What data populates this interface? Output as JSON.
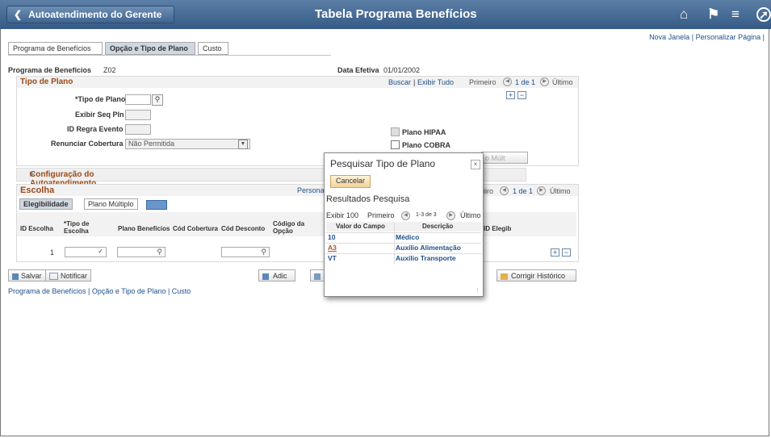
{
  "header": {
    "back_label": "Autoatendimento do Gerente",
    "title": "Tabela Programa Benefícios",
    "home_icon": "home-icon",
    "flag_icon": "flag-icon",
    "menu_icon": "menu-icon",
    "nav_icon": "compass-icon"
  },
  "toplinks": {
    "new_window": "Nova Janela",
    "separator": "|",
    "personalize": "Personalizar Página"
  },
  "tabs": [
    {
      "label": "Programa de Benefícios"
    },
    {
      "label": "Opção e Tipo de Plano"
    },
    {
      "label": "Custo"
    }
  ],
  "program": {
    "label": "Programa de Benefícios",
    "value": "Z02",
    "date_label": "Data Efetiva",
    "date_value": "01/01/2002"
  },
  "plan_type": {
    "title": "Tipo de Plano",
    "search_link": "Buscar",
    "sep": "|",
    "show_all": "Exibir Tudo",
    "first": "Primeiro",
    "pager": "1 de 1",
    "last": "Último",
    "fields": {
      "plan_type_label": "*Tipo de Plano",
      "seq_label": "Exibir Seq Pln",
      "rule_label": "ID Regra Evento",
      "waive_label": "Renunciar Cobertura",
      "waive_value": "Não Permitida"
    },
    "checks": {
      "hipaa": "Plano HIPAA",
      "cobra": "Plano COBRA",
      "multi_btn": "o Múlt"
    }
  },
  "config": {
    "title": "Configuração do Autoatendimento"
  },
  "choice": {
    "title": "Escolha",
    "personalize": "Persona",
    "first": "iiro",
    "pager": "1 de 1",
    "last": "Último",
    "subtabs": [
      {
        "label": "Elegibilidade"
      },
      {
        "label": "Plano Múltiplo"
      }
    ],
    "headers": [
      "ID Escolha",
      "*Tipo de Escolha",
      "Plano Benefícios",
      "Cód Cobertura",
      "Cód Desconto",
      "Código da Opção",
      "ID Elegib"
    ],
    "row": {
      "id": "1"
    }
  },
  "buttons": {
    "save": "Salvar",
    "notify": "Notificar",
    "add": "Adic",
    "correct": "Corrigir Histórico"
  },
  "footlinks": "Programa de Benefícios | Opção e Tipo de Plano | Custo",
  "modal": {
    "title": "Pesquisar Tipo de Plano",
    "cancel": "Cancelar",
    "results": "Resultados Pesquisa",
    "show": "Exibir 100",
    "first": "Primeiro",
    "range": "1-3 de 3",
    "last": "Último",
    "headers": [
      "Valor do Campo",
      "Descrição"
    ],
    "rows": [
      {
        "value": "10",
        "desc": "Médico"
      },
      {
        "value": "A3",
        "desc": "Auxílio Alimentação"
      },
      {
        "value": "VT",
        "desc": "Auxílio Transporte"
      }
    ]
  }
}
